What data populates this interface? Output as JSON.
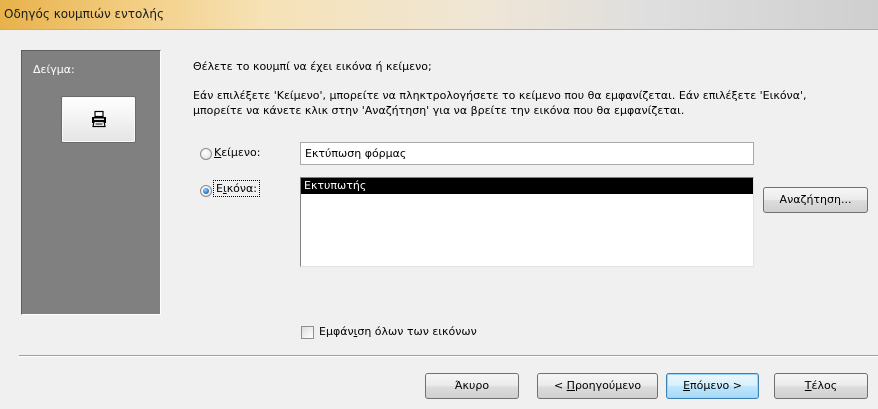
{
  "window": {
    "title": "Οδηγός κουμπιών εντολής"
  },
  "sample": {
    "label": "Δείγμα:",
    "preview_icon": "printer-icon"
  },
  "content": {
    "question": "Θέλετε το κουμπί να έχει εικόνα ή κείμενο;",
    "instructions_line1": "Εάν επιλέξετε 'Κείμενο', μπορείτε να πληκτρολογήσετε το κείμενο που θα εμφανίζεται. Εάν επιλέξετε 'Εικόνα',",
    "instructions_line2": "μπορείτε να κάνετε κλικ στην 'Αναζήτηση' για να βρείτε την εικόνα που θα εμφανίζεται."
  },
  "text_option": {
    "label_mnemonic": "Κ",
    "label_rest": "είμενο:",
    "value": "Εκτύπωση φόρμας",
    "selected": false
  },
  "picture_option": {
    "label_prefix": "Ε",
    "label_mnemonic": "ι",
    "label_rest": "κόνα:",
    "selected": true,
    "items": [
      "Εκτυπωτής"
    ],
    "browse_label": "Αναζήτηση..."
  },
  "show_all": {
    "label_prefix": "Εμφάν",
    "label_mnemonic": "ι",
    "label_rest": "ση όλων των εικόνων",
    "checked": false
  },
  "footer": {
    "cancel_label": "Άκυρο",
    "back_prefix": "< ",
    "back_mnemonic": "Π",
    "back_rest": "ροηγούμενο",
    "next_mnemonic": "Ε",
    "next_rest": "πόμενο >",
    "finish_mnemonic": "Τ",
    "finish_rest": "έλος"
  },
  "colors": {
    "sample_panel": "#808080",
    "selection": "#000000",
    "radio_dot": "#2b7fd6",
    "title_gradient_start": "#e8b24a"
  }
}
